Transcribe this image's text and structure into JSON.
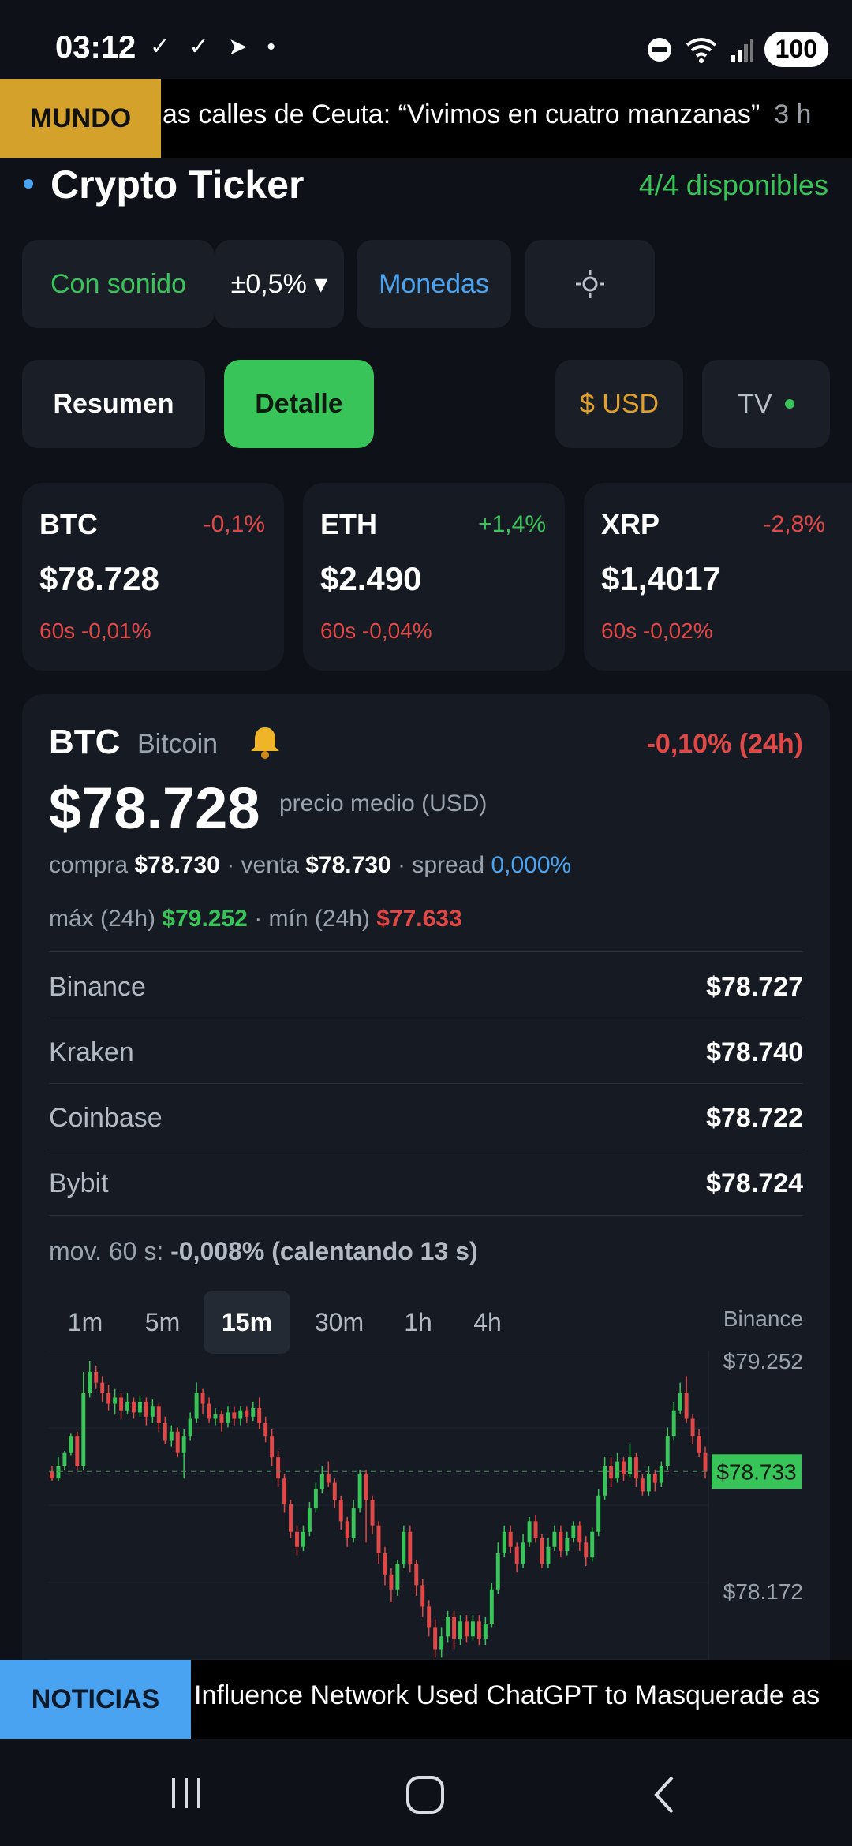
{
  "status_bar": {
    "time": "03:12",
    "left_icons": "✓ ✓ ➤ •",
    "battery": "100"
  },
  "top_ticker": {
    "tag": "MUNDO",
    "text": "as calles de Ceuta: “Vivimos en cuatro manzanas”",
    "age": "3 h"
  },
  "header": {
    "title": "Crypto Ticker",
    "availability": "4/4 disponibles"
  },
  "controls": {
    "sound": "Con sonido",
    "threshold": "±0,5% ▾",
    "coins": "Monedas",
    "settings_icon": "sun-settings-icon"
  },
  "view_tabs": {
    "summary": "Resumen",
    "detail": "Detalle",
    "currency": "$ USD",
    "tv": "TV"
  },
  "coin_cards": [
    {
      "symbol": "BTC",
      "change": "-0,1%",
      "price": "$78.728",
      "sixty": "60s -0,01%",
      "change_color": "#e04848"
    },
    {
      "symbol": "ETH",
      "change": "+1,4%",
      "price": "$2.490",
      "sixty": "60s -0,04%",
      "change_color": "#39c45a"
    },
    {
      "symbol": "XRP",
      "change": "-2,8%",
      "price": "$1,4017",
      "sixty": "60s -0,02%",
      "change_color": "#e04848"
    }
  ],
  "detail": {
    "symbol": "BTC",
    "name": "Bitcoin",
    "change24": "-0,10% (24h)",
    "price": "$78.728",
    "price_note": "precio medio (USD)",
    "buy_label": "compra",
    "buy": "$78.730",
    "sell_label": "· venta",
    "sell": "$78.730",
    "spread_label": "· spread",
    "spread": "0,000%",
    "max_label": "máx (24h)",
    "max": "$79.252",
    "min_label": "· mín (24h)",
    "min": "$77.633",
    "exchanges": [
      {
        "name": "Binance",
        "price": "$78.727"
      },
      {
        "name": "Kraken",
        "price": "$78.740"
      },
      {
        "name": "Coinbase",
        "price": "$78.722"
      },
      {
        "name": "Bybit",
        "price": "$78.724"
      }
    ],
    "mov_label": "mov. 60 s:",
    "mov_value": "-0,008% (calentando 13 s)"
  },
  "chart_controls": {
    "timeframes": [
      "1m",
      "5m",
      "15m",
      "30m",
      "1h",
      "4h"
    ],
    "active": "15m",
    "source": "Binance"
  },
  "chart_data": {
    "type": "candlestick",
    "y_ticks": [
      "$79.252",
      "$78.172"
    ],
    "current_price_label": "$78.733",
    "current_price": 78733,
    "ylim": [
      77850,
      79300
    ],
    "grid": true,
    "candles": [
      [
        78733,
        78700,
        78760,
        78690
      ],
      [
        78700,
        78760,
        78800,
        78690
      ],
      [
        78760,
        78820,
        78830,
        78740
      ],
      [
        78820,
        78900,
        78910,
        78810
      ],
      [
        78900,
        78760,
        78920,
        78740
      ],
      [
        78760,
        79100,
        79200,
        78740
      ],
      [
        79100,
        79200,
        79252,
        79080
      ],
      [
        79200,
        79150,
        79230,
        79120
      ],
      [
        79150,
        79100,
        79180,
        79060
      ],
      [
        79100,
        79050,
        79140,
        79020
      ],
      [
        79050,
        79080,
        79120,
        79000
      ],
      [
        79080,
        79020,
        79100,
        78980
      ],
      [
        79020,
        79060,
        79100,
        79000
      ],
      [
        79060,
        79010,
        79080,
        78980
      ],
      [
        79010,
        79060,
        79090,
        78990
      ],
      [
        79060,
        78990,
        79080,
        78950
      ],
      [
        78990,
        79040,
        79070,
        78960
      ],
      [
        79040,
        78960,
        79050,
        78920
      ],
      [
        78960,
        78880,
        78990,
        78860
      ],
      [
        78880,
        78920,
        78950,
        78850
      ],
      [
        78920,
        78820,
        78940,
        78800
      ],
      [
        78820,
        78900,
        78930,
        78700
      ],
      [
        78900,
        78980,
        79010,
        78880
      ],
      [
        78980,
        79100,
        79150,
        78960
      ],
      [
        79100,
        79050,
        79120,
        79000
      ],
      [
        79050,
        78980,
        79080,
        78960
      ],
      [
        78980,
        79000,
        79030,
        78950
      ],
      [
        79000,
        78960,
        79020,
        78920
      ],
      [
        78960,
        79010,
        79040,
        78940
      ],
      [
        79010,
        78980,
        79040,
        78950
      ],
      [
        78980,
        79020,
        79040,
        78950
      ],
      [
        79020,
        78990,
        79040,
        78960
      ],
      [
        78990,
        79030,
        79060,
        78970
      ],
      [
        79030,
        78960,
        79080,
        78930
      ],
      [
        78960,
        78900,
        78990,
        78870
      ],
      [
        78900,
        78800,
        78930,
        78760
      ],
      [
        78800,
        78700,
        78830,
        78660
      ],
      [
        78700,
        78580,
        78720,
        78540
      ],
      [
        78580,
        78450,
        78600,
        78420
      ],
      [
        78450,
        78380,
        78480,
        78340
      ],
      [
        78380,
        78450,
        78480,
        78360
      ],
      [
        78450,
        78560,
        78590,
        78430
      ],
      [
        78560,
        78650,
        78680,
        78540
      ],
      [
        78650,
        78720,
        78760,
        78630
      ],
      [
        78720,
        78680,
        78780,
        78660
      ],
      [
        78680,
        78600,
        78700,
        78560
      ],
      [
        78600,
        78500,
        78620,
        78460
      ],
      [
        78500,
        78420,
        78520,
        78380
      ],
      [
        78420,
        78560,
        78600,
        78400
      ],
      [
        78560,
        78720,
        78740,
        78540
      ],
      [
        78720,
        78600,
        78740,
        78400
      ],
      [
        78600,
        78480,
        78620,
        78440
      ],
      [
        78480,
        78350,
        78500,
        78300
      ],
      [
        78350,
        78250,
        78380,
        78200
      ],
      [
        78250,
        78180,
        78280,
        78120
      ],
      [
        78180,
        78300,
        78320,
        78150
      ],
      [
        78300,
        78450,
        78480,
        78280
      ],
      [
        78450,
        78300,
        78480,
        78260
      ],
      [
        78300,
        78200,
        78320,
        78150
      ],
      [
        78200,
        78100,
        78230,
        78050
      ],
      [
        78100,
        78000,
        78130,
        77960
      ],
      [
        78000,
        77900,
        78040,
        77860
      ],
      [
        77900,
        77960,
        78000,
        77860
      ],
      [
        77960,
        78050,
        78080,
        77930
      ],
      [
        78050,
        77950,
        78080,
        77900
      ],
      [
        77950,
        78030,
        78060,
        77920
      ],
      [
        78030,
        77960,
        78060,
        77930
      ],
      [
        77960,
        78030,
        78060,
        77940
      ],
      [
        78030,
        77950,
        78060,
        77920
      ],
      [
        77950,
        78020,
        78050,
        77920
      ],
      [
        78020,
        78180,
        78210,
        78000
      ],
      [
        78180,
        78350,
        78400,
        78160
      ],
      [
        78350,
        78450,
        78480,
        78330
      ],
      [
        78450,
        78380,
        78480,
        78350
      ],
      [
        78380,
        78300,
        78400,
        78260
      ],
      [
        78300,
        78400,
        78440,
        78280
      ],
      [
        78400,
        78500,
        78520,
        78380
      ],
      [
        78500,
        78420,
        78530,
        78400
      ],
      [
        78420,
        78300,
        78440,
        78280
      ],
      [
        78300,
        78380,
        78420,
        78280
      ],
      [
        78380,
        78450,
        78480,
        78360
      ],
      [
        78450,
        78360,
        78480,
        78330
      ],
      [
        78360,
        78420,
        78450,
        78340
      ],
      [
        78420,
        78480,
        78500,
        78400
      ],
      [
        78480,
        78400,
        78500,
        78360
      ],
      [
        78400,
        78330,
        78430,
        78290
      ],
      [
        78330,
        78450,
        78470,
        78310
      ],
      [
        78450,
        78620,
        78650,
        78430
      ],
      [
        78620,
        78760,
        78800,
        78600
      ],
      [
        78760,
        78700,
        78800,
        78660
      ],
      [
        78700,
        78780,
        78820,
        78680
      ],
      [
        78780,
        78720,
        78800,
        78690
      ],
      [
        78720,
        78800,
        78860,
        78700
      ],
      [
        78800,
        78700,
        78820,
        78660
      ],
      [
        78700,
        78640,
        78720,
        78620
      ],
      [
        78640,
        78720,
        78760,
        78620
      ],
      [
        78720,
        78680,
        78740,
        78640
      ],
      [
        78680,
        78760,
        78780,
        78660
      ],
      [
        78760,
        78900,
        78940,
        78740
      ],
      [
        78900,
        79020,
        79060,
        78880
      ],
      [
        79020,
        79100,
        79150,
        79000
      ],
      [
        79100,
        78980,
        79180,
        78960
      ],
      [
        78980,
        78900,
        79000,
        78860
      ],
      [
        78900,
        78820,
        78930,
        78800
      ],
      [
        78820,
        78733,
        78850,
        78700
      ]
    ]
  },
  "bottom_ticker": {
    "tag": "NOTICIAS",
    "text": "Influence Network Used ChatGPT to Masquerade as"
  },
  "nav": {
    "recents_icon": "recents-icon",
    "home_icon": "home-icon",
    "back_icon": "back-icon"
  }
}
